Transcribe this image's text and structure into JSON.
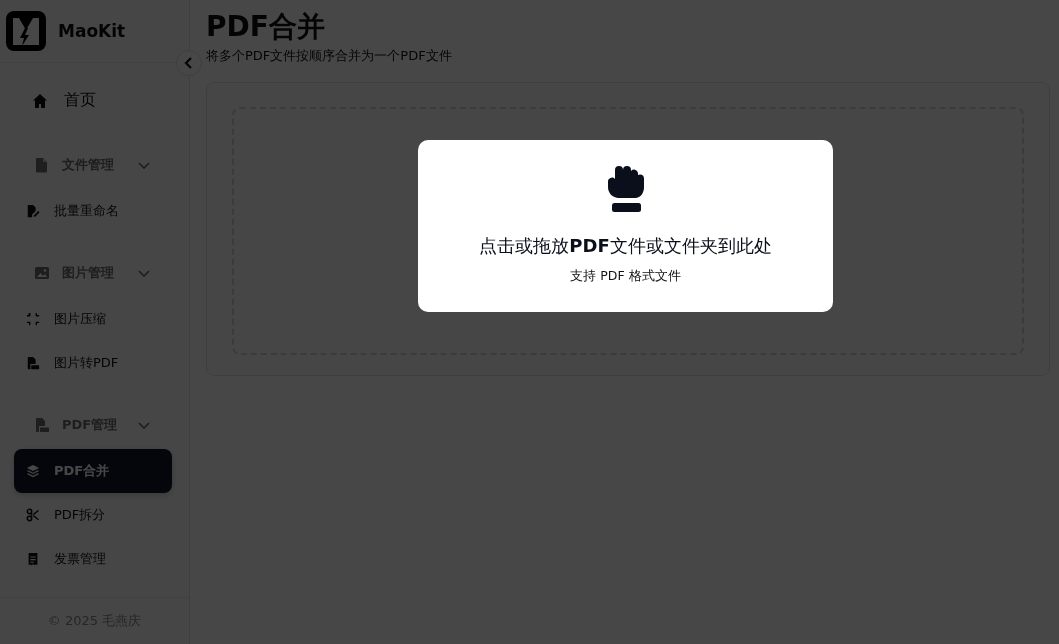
{
  "app": {
    "name": "MaoKit"
  },
  "sidebar": {
    "items": [
      {
        "kind": "link",
        "label": "首页",
        "selected": false
      },
      {
        "kind": "group",
        "label": "文件管理",
        "expanded": true,
        "children": [
          {
            "kind": "link",
            "label": "批量重命名",
            "selected": false
          }
        ]
      },
      {
        "kind": "group",
        "label": "图片管理",
        "expanded": true,
        "children": [
          {
            "kind": "link",
            "label": "图片压缩",
            "selected": false
          },
          {
            "kind": "link",
            "label": "图片转PDF",
            "selected": false
          }
        ]
      },
      {
        "kind": "group",
        "label": "PDF管理",
        "expanded": true,
        "children": [
          {
            "kind": "link",
            "label": "PDF合并",
            "selected": true
          },
          {
            "kind": "link",
            "label": "PDF拆分",
            "selected": false
          },
          {
            "kind": "link",
            "label": "发票管理",
            "selected": false
          }
        ]
      }
    ],
    "footer": "© 2025 毛燕庆"
  },
  "page": {
    "title": "PDF合并",
    "subtitle": "将多个PDF文件按顺序合并为一个PDF文件"
  },
  "drop_dialog": {
    "heading": "点击或拖放**PDF**文件或文件夹到此处",
    "hint": "支持 PDF 格式文件"
  }
}
